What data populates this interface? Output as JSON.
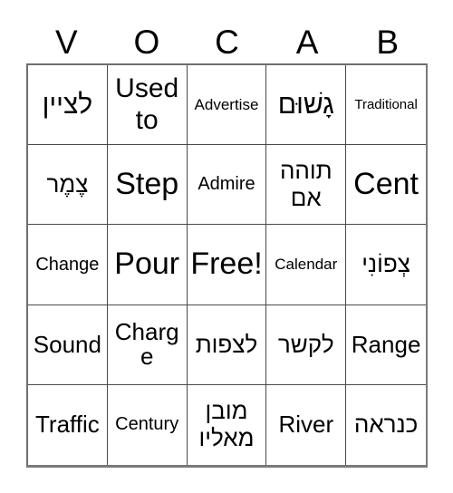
{
  "card": {
    "title_letters": [
      "V",
      "O",
      "C",
      "A",
      "B"
    ],
    "grid_size": "5x5",
    "colors": {
      "background": "#ffffff",
      "text": "#000000",
      "grid_line": "#4a4a4a",
      "outer_border": "#7a7a7a"
    },
    "rows": [
      [
        {
          "text": "לציין",
          "script": "hebrew",
          "size": "lg",
          "lines": 1
        },
        {
          "text": "Used to",
          "script": "latin",
          "size": "lg",
          "lines": 2
        },
        {
          "text": "Advertise",
          "script": "latin",
          "size": "xs",
          "lines": 1
        },
        {
          "text": "גָשׁוּם",
          "script": "hebrew",
          "size": "lg",
          "lines": 1
        },
        {
          "text": "Traditional",
          "script": "latin",
          "size": "xxs",
          "lines": 1
        }
      ],
      [
        {
          "text": "צֶמֶר",
          "script": "hebrew",
          "size": "md",
          "lines": 1
        },
        {
          "text": "Step",
          "script": "latin",
          "size": "xl",
          "lines": 1
        },
        {
          "text": "Admire",
          "script": "latin",
          "size": "sm",
          "lines": 1
        },
        {
          "text": "תוהה אם",
          "script": "hebrew",
          "size": "md",
          "lines": 2
        },
        {
          "text": "Cent",
          "script": "latin",
          "size": "xl",
          "lines": 1
        }
      ],
      [
        {
          "text": "Change",
          "script": "latin",
          "size": "sm",
          "lines": 1
        },
        {
          "text": "Pour",
          "script": "latin",
          "size": "xl",
          "lines": 1
        },
        {
          "text": "Free!",
          "script": "latin",
          "size": "xl",
          "lines": 1
        },
        {
          "text": "Calendar",
          "script": "latin",
          "size": "xs",
          "lines": 1
        },
        {
          "text": "צְפוֹנִי",
          "script": "hebrew",
          "size": "md",
          "lines": 1
        }
      ],
      [
        {
          "text": "Sound",
          "script": "latin",
          "size": "md",
          "lines": 1
        },
        {
          "text": "Charge",
          "script": "latin",
          "size": "md",
          "lines": 1
        },
        {
          "text": "לצפות",
          "script": "hebrew",
          "size": "md",
          "lines": 1
        },
        {
          "text": "לקשר",
          "script": "hebrew",
          "size": "md",
          "lines": 1
        },
        {
          "text": "Range",
          "script": "latin",
          "size": "md",
          "lines": 1
        }
      ],
      [
        {
          "text": "Traffic",
          "script": "latin",
          "size": "md",
          "lines": 1
        },
        {
          "text": "Century",
          "script": "latin",
          "size": "sm",
          "lines": 1
        },
        {
          "text": "מובן מאליו",
          "script": "hebrew",
          "size": "md",
          "lines": 2
        },
        {
          "text": "River",
          "script": "latin",
          "size": "md",
          "lines": 1
        },
        {
          "text": "כנראה",
          "script": "hebrew",
          "size": "md",
          "lines": 1
        }
      ]
    ]
  }
}
